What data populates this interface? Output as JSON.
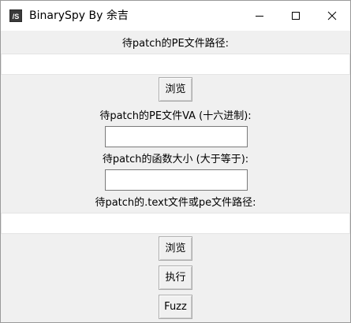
{
  "window": {
    "title": "BinarySpy By 余吉",
    "icon": "app-icon"
  },
  "titlebar_buttons": {
    "minimize": "minimize-icon",
    "maximize": "maximize-icon",
    "close": "close-icon"
  },
  "form": {
    "pe_path_label": "待patch的PE文件路径:",
    "pe_path_value": "",
    "browse1_label": "浏览",
    "va_label": "待patch的PE文件VA (十六进制):",
    "va_value": "",
    "func_size_label": "待patch的函数大小 (大于等于):",
    "func_size_value": "",
    "text_path_label": "待patch的.text文件或pe文件路径:",
    "text_path_value": "",
    "browse2_label": "浏览",
    "execute_label": "执行",
    "fuzz_label": "Fuzz"
  }
}
